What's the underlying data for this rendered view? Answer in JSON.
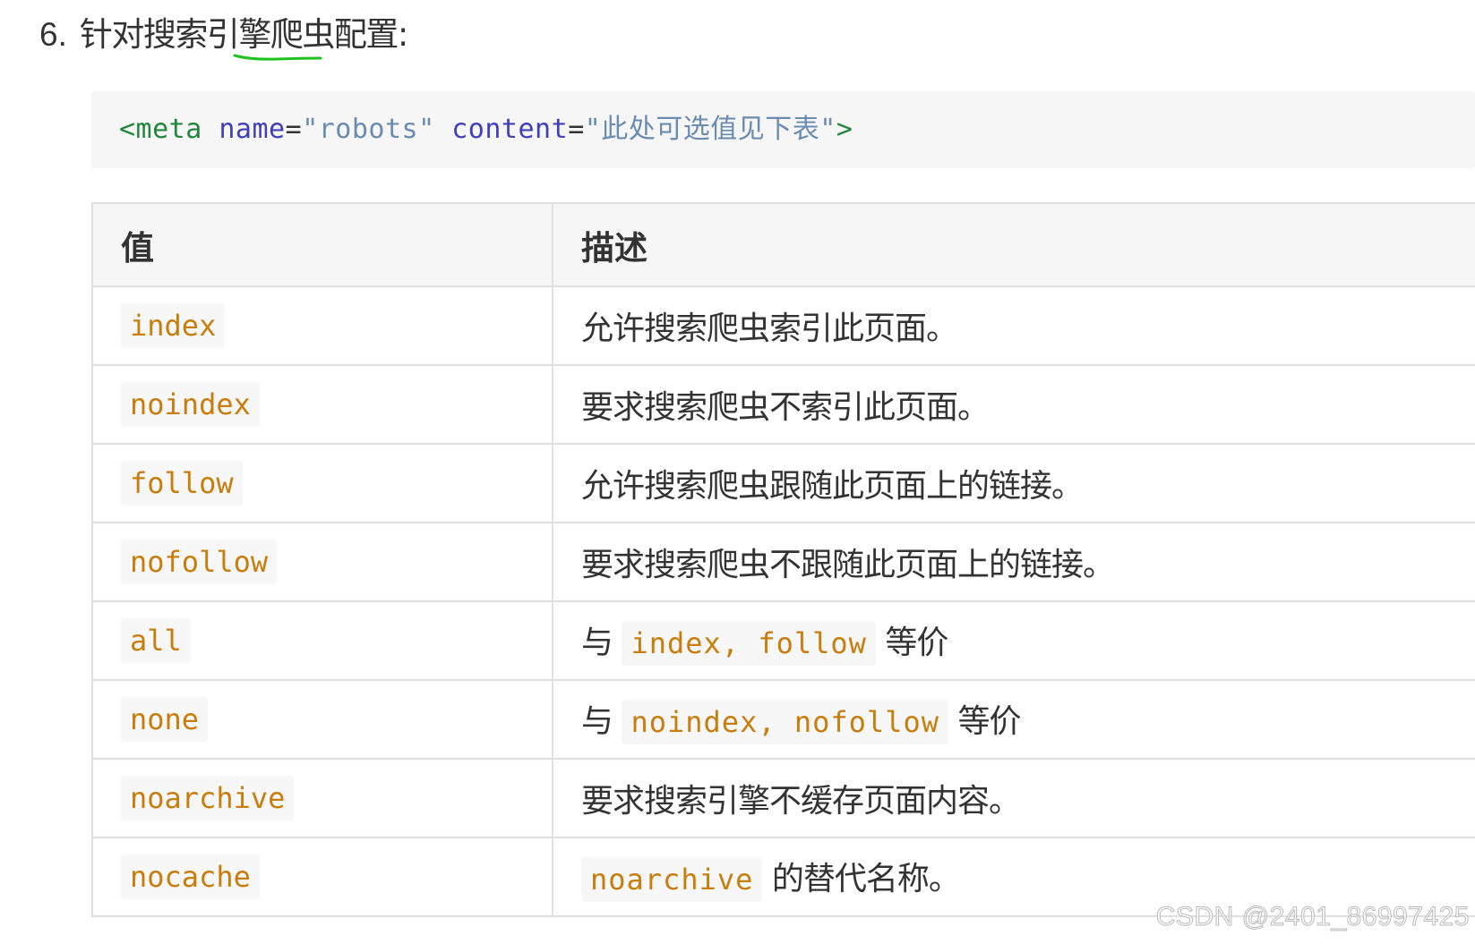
{
  "heading": {
    "number": "6.",
    "text_before": "针对搜索引",
    "text_underlined": "擎爬虫",
    "text_after": "配置:"
  },
  "code_snippet": {
    "open": "<meta",
    "attr1_name": "name",
    "eq": "=",
    "attr1_value": "\"robots\"",
    "attr2_name": "content",
    "attr2_value": "\"此处可选值见下表\"",
    "close": ">"
  },
  "table": {
    "headers": [
      "值",
      "描述"
    ],
    "rows": [
      {
        "value": "index",
        "desc": "允许搜索爬虫索引此页面。"
      },
      {
        "value": "noindex",
        "desc": "要求搜索爬虫不索引此页面。"
      },
      {
        "value": "follow",
        "desc": "允许搜索爬虫跟随此页面上的链接。"
      },
      {
        "value": "nofollow",
        "desc": "要求搜索爬虫不跟随此页面上的链接。"
      },
      {
        "value": "all",
        "desc_prefix": "与",
        "desc_code": "index, follow",
        "desc_suffix": "等价"
      },
      {
        "value": "none",
        "desc_prefix": "与",
        "desc_code": "noindex, nofollow",
        "desc_suffix": "等价"
      },
      {
        "value": "noarchive",
        "desc": "要求搜索引擎不缓存页面内容。"
      },
      {
        "value": "nocache",
        "desc_code": "noarchive",
        "desc_suffix": "的替代名称。"
      }
    ]
  },
  "watermark": "CSDN @2401_86997425",
  "colors": {
    "code_value": "#c87d0c",
    "tag": "#22863a",
    "attr": "#3f3fb8",
    "string": "#6a8caf",
    "underline": "#1ec31e"
  }
}
